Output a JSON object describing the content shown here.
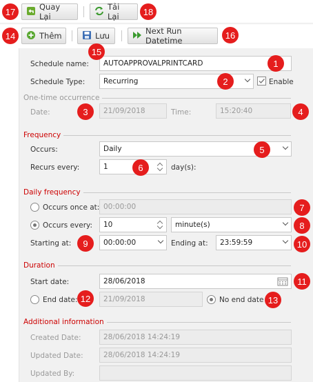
{
  "toolbar_row1": {
    "back_label": "Quay Lại",
    "reload_label": "Tải Lại"
  },
  "toolbar_row2": {
    "add_label": "Thêm",
    "save_label": "Lưu",
    "next_run_label": "Next Run Datetime"
  },
  "badges": [
    "1",
    "2",
    "3",
    "4",
    "5",
    "6",
    "7",
    "8",
    "9",
    "10",
    "11",
    "12",
    "13",
    "14",
    "15",
    "16",
    "17",
    "18"
  ],
  "schedule": {
    "name_label": "Schedule name:",
    "name_value": "AUTOAPPROVALPRINTCARD",
    "type_label": "Schedule Type:",
    "type_value": "Recurring",
    "enable_label": "Enable",
    "enable_checked": true
  },
  "one_time": {
    "title": "One-time occurrence",
    "date_label": "Date:",
    "date_value": "21/09/2018",
    "time_label": "Time:",
    "time_value": "15:20:40"
  },
  "frequency": {
    "title": "Frequency",
    "occurs_label": "Occurs:",
    "occurs_value": "Daily",
    "recurs_label": "Recurs every:",
    "recurs_value": "1",
    "recurs_unit": "day(s):"
  },
  "daily": {
    "title": "Daily frequency",
    "once_label": "Occurs once at:",
    "once_value": "00:00:00",
    "every_label": "Occurs every:",
    "every_value": "10",
    "every_unit": "minute(s)",
    "starting_label": "Starting at:",
    "starting_value": "00:00:00",
    "ending_label": "Ending at:",
    "ending_value": "23:59:59"
  },
  "duration": {
    "title": "Duration",
    "start_label": "Start date:",
    "start_value": "28/06/2018",
    "end_label": "End date:",
    "end_value": "21/09/2018",
    "no_end_label": "No end date"
  },
  "additional": {
    "title": "Additional information",
    "created_label": "Created Date:",
    "created_value": "28/06/2018 14:24:19",
    "updated_label": "Updated Date:",
    "updated_value": "28/06/2018 14:24:19",
    "updated_by_label": "Updated By:"
  },
  "colors": {
    "accent_red": "#e51d1d",
    "section_title": "#cc0000",
    "panel_bg": "#f1f1f1"
  }
}
